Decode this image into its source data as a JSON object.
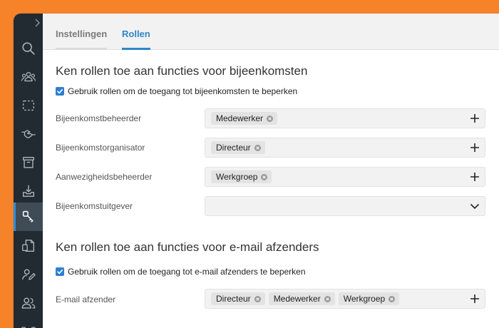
{
  "tabs": [
    {
      "label": "Instellingen",
      "active": false
    },
    {
      "label": "Rollen",
      "active": true
    }
  ],
  "sidebar": {
    "items": [
      {
        "icon": "search-icon"
      },
      {
        "icon": "users-icon"
      },
      {
        "icon": "selection-icon"
      },
      {
        "icon": "handshake-icon"
      },
      {
        "icon": "archive-icon"
      },
      {
        "icon": "download-icon"
      },
      {
        "icon": "key-icon",
        "active": true
      },
      {
        "icon": "document-icon"
      },
      {
        "icon": "user-edit-icon"
      },
      {
        "icon": "user-group-icon"
      },
      {
        "icon": "connection-icon"
      }
    ]
  },
  "meetings_section": {
    "title": "Ken rollen toe aan functies voor bijeenkomsten",
    "checkbox_label": "Gebruik rollen om de toegang tot bijeenkomsten te beperken",
    "checked": true,
    "fields": [
      {
        "label": "Bijeenkomstbeheerder",
        "chips": [
          "Medewerker"
        ],
        "control": "plus-icon"
      },
      {
        "label": "Bijeenkomstorganisator",
        "chips": [
          "Directeur"
        ],
        "control": "plus-icon"
      },
      {
        "label": "Aanwezigheidsbeheerder",
        "chips": [
          "Werkgroep"
        ],
        "control": "plus-icon"
      },
      {
        "label": "Bijeenkomstuitgever",
        "chips": [],
        "control": "chevron-down-icon"
      }
    ]
  },
  "email_section": {
    "title": "Ken rollen toe aan functies voor e-mail afzenders",
    "checkbox_label": "Gebruik rollen om de toegang tot e-mail afzenders te beperken",
    "checked": true,
    "fields": [
      {
        "label": "E-mail afzender",
        "chips": [
          "Directeur",
          "Medewerker",
          "Werkgroep"
        ],
        "control": "plus-icon"
      }
    ]
  },
  "colors": {
    "background": "#f6822a",
    "sidebar": "#222a32",
    "sidebar_active": "#3f4c58",
    "accent": "#2f86c7"
  }
}
